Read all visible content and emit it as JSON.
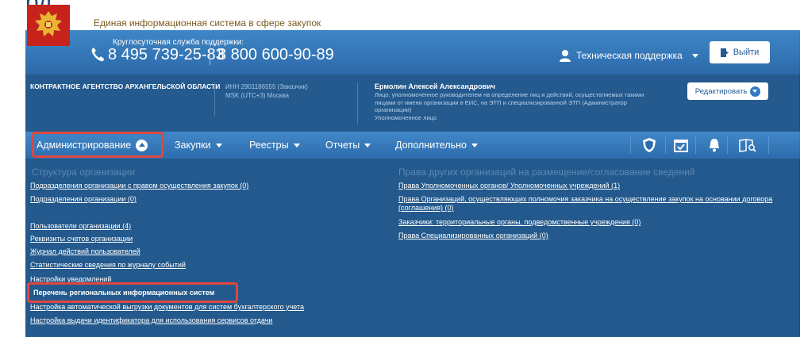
{
  "header": {
    "big_fragment": "рд",
    "site_title": "Единая информационная система в сфере закупок",
    "support_label": "Круглосуточная служба поддержки:",
    "phone_1": "8 495 739-25-83",
    "phone_2": "8 800 600-90-89",
    "support_link": "Техническая поддержка",
    "logout_label": "Выйти"
  },
  "org": {
    "name": "КОНТРАКТНОЕ АГЕНТСТВО АРХАНГЕЛЬСКОЙ ОБЛАСТИ",
    "inn": "ИНН 2901186555 (Заказчик)",
    "timezone": "MSK (UTC+3) Москва",
    "person_name": "Ермолин Алексей Александрович",
    "person_desc": "Лицо, уполномоченное руководителем на определение лиц и действий, осуществляемых такими лицами от имени организации в ЕИС, на ЭТП и специализированной ЭТП (Администратор организации)",
    "person_role": "Уполномоченное лицо",
    "edit_label": "Редактировать"
  },
  "nav": {
    "admin": "Администрирование",
    "purchases": "Закупки",
    "registries": "Реестры",
    "reports": "Отчеты",
    "more": "Дополнительно"
  },
  "menu": {
    "left_heading": "Структура организации",
    "left_links": [
      "Подразделения организации с правом осуществления закупок (0)",
      "Подразделения организации (0)",
      "Пользователи организации (4)",
      "Реквизиты счетов организации",
      "Журнал действий пользователей",
      "Статистические сведения по журналу событий",
      "Настройки уведомлений",
      "Перечень региональных информационных систем",
      "Настройка автоматической выгрузки документов для систем бухгалтерского учета",
      "Настройка выдачи идентификатора для использования сервисов отдачи"
    ],
    "right_heading": "Права других организаций на размещение/согласование сведений",
    "right_links": [
      "Права Уполномоченных органов/ Уполномоченных учреждений (1)",
      "Права Организаций, осуществляющих полномочия заказчика на осуществление закупок на основании договора (соглашения) (0)",
      "Заказчики: территориальные органы, подведомственные учреждения (0)",
      "Права Специализированных организаций (0)"
    ]
  },
  "colors": {
    "highlight": "#e0463e",
    "panel": "#23598c",
    "nav": "#2d6cac"
  }
}
